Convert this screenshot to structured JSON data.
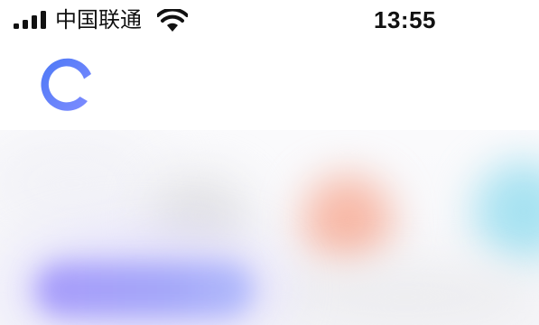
{
  "status_bar": {
    "carrier": "中国联通",
    "time": "13:55",
    "signal_bars": 4,
    "icons": [
      "cellular-signal-icon",
      "wifi-icon"
    ]
  },
  "header": {
    "logo": "app-logo-icon",
    "colors": {
      "logo_start": "#4d79f6",
      "logo_end": "#7f8cff"
    }
  },
  "content": {
    "state": "blurred",
    "colors": {
      "purple_button": "#a79bfa",
      "peach_blob": "#f7b8a6",
      "cyan_blob": "#a7e2f1",
      "gray_blob": "#e3e3e6"
    }
  }
}
